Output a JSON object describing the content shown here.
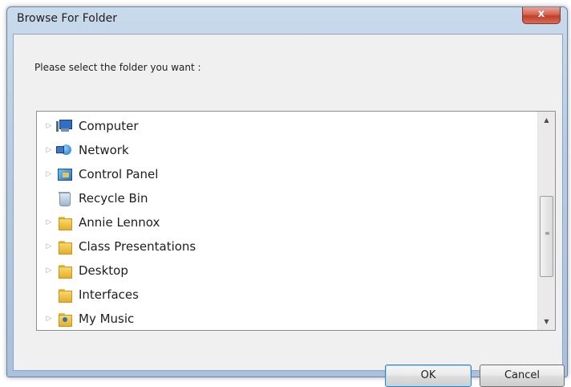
{
  "window": {
    "title": "Browse For Folder",
    "close_label": "x"
  },
  "dialog": {
    "prompt": "Please select the folder you want :"
  },
  "tree": {
    "items": [
      {
        "label": "Computer",
        "icon": "computer-icon",
        "expandable": true
      },
      {
        "label": "Network",
        "icon": "network-icon",
        "expandable": true
      },
      {
        "label": "Control Panel",
        "icon": "control-panel-icon",
        "expandable": true
      },
      {
        "label": "Recycle Bin",
        "icon": "recycle-bin-icon",
        "expandable": false
      },
      {
        "label": "Annie Lennox",
        "icon": "folder-icon",
        "expandable": true
      },
      {
        "label": "Class Presentations",
        "icon": "folder-icon",
        "expandable": true
      },
      {
        "label": "Desktop",
        "icon": "folder-icon",
        "expandable": true
      },
      {
        "label": "Interfaces",
        "icon": "folder-icon",
        "expandable": false
      },
      {
        "label": "My Music",
        "icon": "music-folder-icon",
        "expandable": true
      }
    ],
    "expander_glyph": "▷",
    "scroll_up_glyph": "▲",
    "scroll_down_glyph": "▼",
    "scroll_grip_glyph": "≡"
  },
  "buttons": {
    "ok_label": "OK",
    "cancel_label": "Cancel"
  },
  "colors": {
    "title_bar": "#b7cce3",
    "close_button": "#c1402b",
    "ok_focus_border": "#3c7fb1"
  }
}
